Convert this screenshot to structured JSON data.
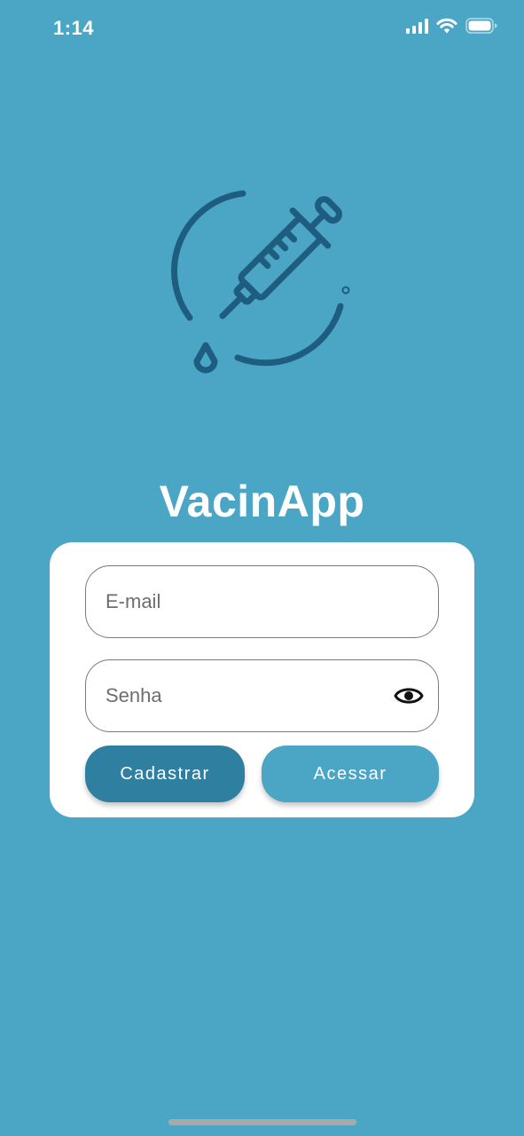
{
  "status_bar": {
    "time": "1:14",
    "icons": [
      "signal-icon",
      "wifi-icon",
      "battery-icon"
    ]
  },
  "logo": {
    "icon": "syringe-icon",
    "color": "#1f5d80"
  },
  "app": {
    "title": "VacinApp"
  },
  "form": {
    "email": {
      "value": "",
      "placeholder": "E-mail"
    },
    "password": {
      "value": "",
      "placeholder": "Senha",
      "toggle_icon": "eye-icon"
    },
    "register_label": "Cadastrar",
    "login_label": "Acessar"
  },
  "colors": {
    "background": "#4aa6c4",
    "primary_dark": "#2f7fa0",
    "card": "#ffffff"
  }
}
